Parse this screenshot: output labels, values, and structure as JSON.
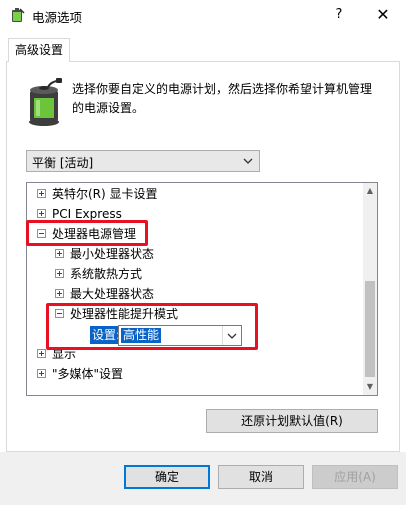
{
  "window": {
    "title": "电源选项",
    "help_label": "?",
    "close_label": "✕"
  },
  "tab": {
    "label": "高级设置"
  },
  "description": "选择你要自定义的电源计划，然后选择你希望计算机管理的电源设置。",
  "plan_select": {
    "value": "平衡 [活动]"
  },
  "tree": {
    "items": [
      {
        "label": "英特尔(R) 显卡设置",
        "expanded": false
      },
      {
        "label": "PCI Express",
        "expanded": false
      },
      {
        "label": "处理器电源管理",
        "expanded": true
      },
      {
        "label": "最小处理器状态",
        "expanded": false
      },
      {
        "label": "系统散热方式",
        "expanded": false
      },
      {
        "label": "最大处理器状态",
        "expanded": false
      },
      {
        "label": "处理器性能提升模式",
        "expanded": true
      },
      {
        "label": "显示",
        "expanded": false
      },
      {
        "label": "\"多媒体\"设置",
        "expanded": false
      }
    ],
    "setting_label": "设置:",
    "setting_value": "高性能"
  },
  "buttons": {
    "restore": "还原计划默认值(R)",
    "ok": "确定",
    "cancel": "取消",
    "apply": "应用(A)"
  },
  "colors": {
    "highlight": "#0a64c8",
    "annotation": "#e81123",
    "accent": "#0078d7"
  }
}
